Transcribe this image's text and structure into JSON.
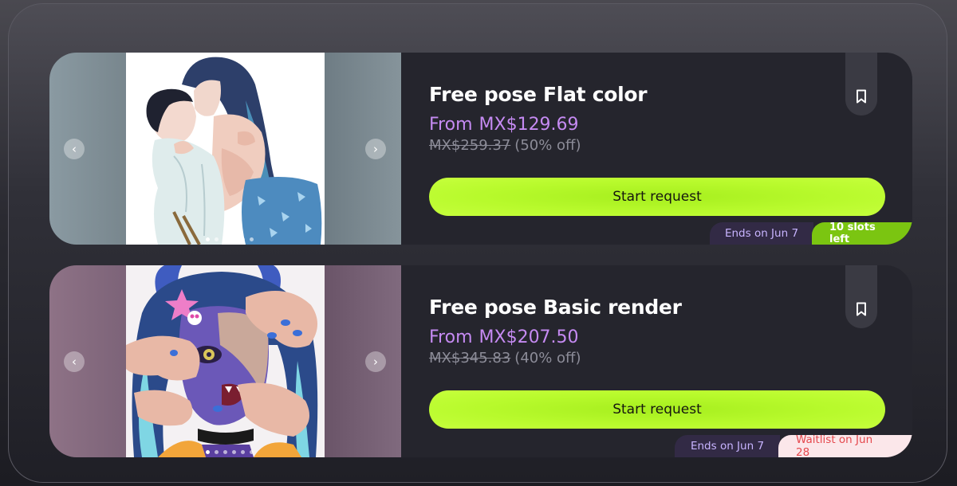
{
  "cards": [
    {
      "title": "Free pose Flat color",
      "price_prefix": "From",
      "price": "MX$129.69",
      "original_price": "MX$259.37",
      "discount": "(50% off)",
      "cta_label": "Start request",
      "end_date": "Ends on Jun 7",
      "status": "10 slots left",
      "status_color": "#7bc511",
      "carousel_prev_icon": "chevron-left-icon",
      "carousel_next_icon": "chevron-right-icon",
      "bookmark_icon": "bookmark-icon",
      "image_count": 6
    },
    {
      "title": "Free pose Basic render",
      "price_prefix": "From",
      "price": "MX$207.50",
      "original_price": "MX$345.83",
      "discount": "(40% off)",
      "cta_label": "Start request",
      "end_date": "Ends on Jun 7",
      "status": "Waitlist on Jun 28",
      "status_color": "#e5484d",
      "carousel_prev_icon": "chevron-left-icon",
      "carousel_next_icon": "chevron-right-icon",
      "bookmark_icon": "bookmark-icon",
      "image_count": 6
    }
  ],
  "colors": {
    "accent_button": "#b8fa2c",
    "price": "#c58af2",
    "card_background": "#25252d"
  }
}
